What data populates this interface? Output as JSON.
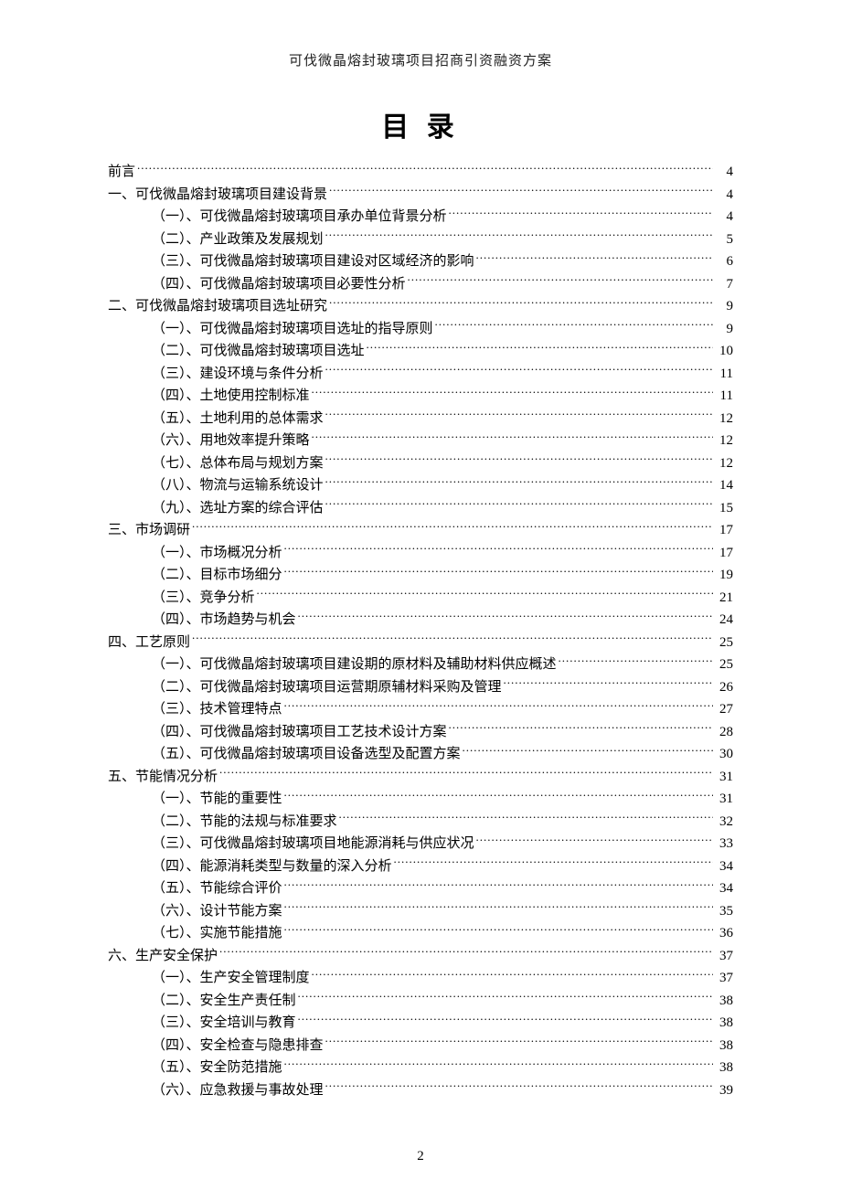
{
  "header": "可伐微晶熔封玻璃项目招商引资融资方案",
  "title": "目 录",
  "page_number": "2",
  "toc": [
    {
      "label": "前言",
      "page": "4",
      "level": 0
    },
    {
      "label": "一、可伐微晶熔封玻璃项目建设背景",
      "page": "4",
      "level": 1
    },
    {
      "label": "（一）、可伐微晶熔封玻璃项目承办单位背景分析",
      "page": "4",
      "level": 2
    },
    {
      "label": "（二）、产业政策及发展规划",
      "page": "5",
      "level": 2
    },
    {
      "label": "（三）、可伐微晶熔封玻璃项目建设对区域经济的影响",
      "page": "6",
      "level": 2
    },
    {
      "label": "（四）、可伐微晶熔封玻璃项目必要性分析",
      "page": "7",
      "level": 2
    },
    {
      "label": "二、可伐微晶熔封玻璃项目选址研究",
      "page": "9",
      "level": 1
    },
    {
      "label": "（一）、可伐微晶熔封玻璃项目选址的指导原则",
      "page": "9",
      "level": 2
    },
    {
      "label": "（二）、可伐微晶熔封玻璃项目选址",
      "page": "10",
      "level": 2
    },
    {
      "label": "（三）、建设环境与条件分析",
      "page": "11",
      "level": 2
    },
    {
      "label": "（四）、土地使用控制标准",
      "page": "11",
      "level": 2
    },
    {
      "label": "（五）、土地利用的总体需求",
      "page": "12",
      "level": 2
    },
    {
      "label": "（六）、用地效率提升策略",
      "page": "12",
      "level": 2
    },
    {
      "label": "（七）、总体布局与规划方案",
      "page": "12",
      "level": 2
    },
    {
      "label": "（八）、物流与运输系统设计",
      "page": "14",
      "level": 2
    },
    {
      "label": "（九）、选址方案的综合评估",
      "page": "15",
      "level": 2
    },
    {
      "label": "三、市场调研",
      "page": "17",
      "level": 1
    },
    {
      "label": "（一）、市场概况分析",
      "page": "17",
      "level": 2
    },
    {
      "label": "（二）、目标市场细分",
      "page": "19",
      "level": 2
    },
    {
      "label": "（三）、竞争分析",
      "page": "21",
      "level": 2
    },
    {
      "label": "（四）、市场趋势与机会",
      "page": "24",
      "level": 2
    },
    {
      "label": "四、工艺原则",
      "page": "25",
      "level": 1
    },
    {
      "label": "（一）、可伐微晶熔封玻璃项目建设期的原材料及辅助材料供应概述",
      "page": "25",
      "level": 2
    },
    {
      "label": "（二）、可伐微晶熔封玻璃项目运营期原辅材料采购及管理",
      "page": "26",
      "level": 2
    },
    {
      "label": "（三）、技术管理特点",
      "page": "27",
      "level": 2
    },
    {
      "label": "（四）、可伐微晶熔封玻璃项目工艺技术设计方案",
      "page": "28",
      "level": 2
    },
    {
      "label": "（五）、可伐微晶熔封玻璃项目设备选型及配置方案",
      "page": "30",
      "level": 2
    },
    {
      "label": "五、节能情况分析",
      "page": "31",
      "level": 1
    },
    {
      "label": "（一）、节能的重要性",
      "page": "31",
      "level": 2
    },
    {
      "label": "（二）、节能的法规与标准要求",
      "page": "32",
      "level": 2
    },
    {
      "label": "（三）、可伐微晶熔封玻璃项目地能源消耗与供应状况",
      "page": "33",
      "level": 2
    },
    {
      "label": "（四）、能源消耗类型与数量的深入分析",
      "page": "34",
      "level": 2
    },
    {
      "label": "（五）、节能综合评价",
      "page": "34",
      "level": 2
    },
    {
      "label": "（六）、设计节能方案",
      "page": "35",
      "level": 2
    },
    {
      "label": "（七）、实施节能措施",
      "page": "36",
      "level": 2
    },
    {
      "label": "六、生产安全保护",
      "page": "37",
      "level": 1
    },
    {
      "label": "（一）、生产安全管理制度",
      "page": "37",
      "level": 2
    },
    {
      "label": "（二）、安全生产责任制",
      "page": "38",
      "level": 2
    },
    {
      "label": "（三）、安全培训与教育",
      "page": "38",
      "level": 2
    },
    {
      "label": "（四）、安全检查与隐患排查",
      "page": "38",
      "level": 2
    },
    {
      "label": "（五）、安全防范措施",
      "page": "38",
      "level": 2
    },
    {
      "label": "（六）、应急救援与事故处理",
      "page": "39",
      "level": 2
    }
  ]
}
